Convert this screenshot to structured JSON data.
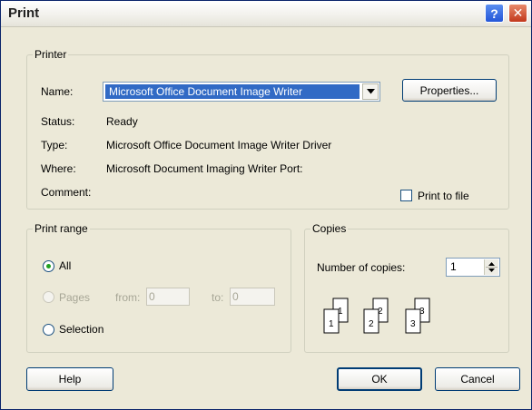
{
  "title": "Print",
  "title_buttons": {
    "help": "?",
    "close": "✕"
  },
  "printer": {
    "legend": "Printer",
    "name_label": "Name:",
    "name_value": "Microsoft Office Document Image Writer",
    "properties_button": "Properties...",
    "status_label": "Status:",
    "status_value": "Ready",
    "type_label": "Type:",
    "type_value": "Microsoft Office Document Image Writer Driver",
    "where_label": "Where:",
    "where_value": "Microsoft Document Imaging Writer Port:",
    "comment_label": "Comment:",
    "print_to_file_label": "Print to file",
    "print_to_file_checked": false
  },
  "print_range": {
    "legend": "Print range",
    "selected": "All",
    "all_label": "All",
    "pages_label": "Pages",
    "from_label": "from:",
    "from_value": "0",
    "to_label": "to:",
    "to_value": "0",
    "selection_label": "Selection"
  },
  "copies": {
    "legend": "Copies",
    "number_label": "Number of copies:",
    "number_value": "1",
    "collate_icon": "collate-pages-icon"
  },
  "buttons": {
    "help": "Help",
    "ok": "OK",
    "cancel": "Cancel"
  },
  "colors": {
    "selection": "#316ac5",
    "radio_dot": "#21a121",
    "close": "#c2381c"
  }
}
